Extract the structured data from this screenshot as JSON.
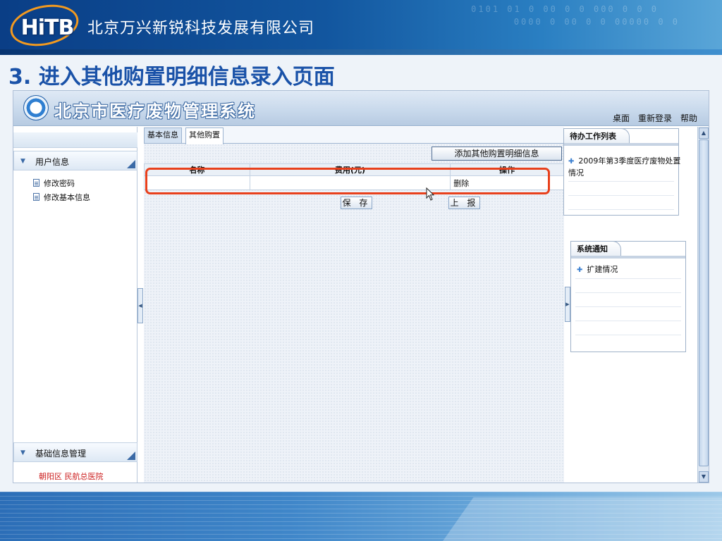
{
  "banner": {
    "logo_text": "HiTB",
    "company": "北京万兴新锐科技发展有限公司",
    "bits_1": "0101 01 0 00   0 0 000 0   0   0",
    "bits_2": "0000 0 00   0 0 00000  0   0"
  },
  "slide_title": "3. 进入其他购置明细信息录入页面",
  "app": {
    "system_title": "北京市医疗废物管理系统",
    "top_nav": [
      "桌面",
      "重新登录",
      "帮助"
    ],
    "sidebar": {
      "group1_label": "用户信息",
      "items": [
        "修改密码",
        "修改基本信息"
      ],
      "group2_label": "基础信息管理",
      "footer": "朝阳区   民航总医院"
    },
    "tabs": [
      "基本信息",
      "其他购置"
    ],
    "add_button": "添加其他购置明细信息",
    "table": {
      "headers": [
        "名称",
        "费用(元)",
        "操作"
      ],
      "rows": [
        [
          "",
          "",
          "删除"
        ]
      ]
    },
    "save_button": "保 存",
    "report_button": "上 报",
    "todo_panel": {
      "title": "待办工作列表",
      "items": [
        "2009年第3季度医疗废物处置情况"
      ]
    },
    "notice_panel": {
      "title": "系统通知",
      "items": [
        "扩建情况"
      ]
    }
  },
  "colors": {
    "title_blue": "#1a52a8",
    "highlight_red": "#e8401c",
    "logo_orange": "#f39a1f"
  }
}
